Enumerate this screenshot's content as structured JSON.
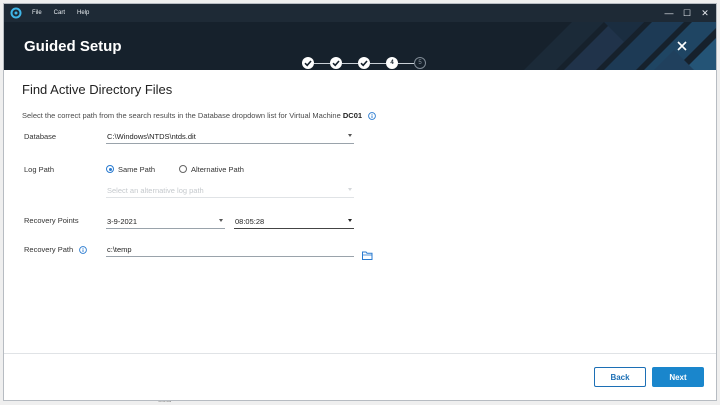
{
  "window": {
    "menu": [
      "File",
      "Cart",
      "Help"
    ],
    "controls": {
      "minimize": "—",
      "maximize": "☐",
      "close": "✕"
    }
  },
  "header": {
    "title": "Guided Setup",
    "steps": [
      {
        "state": "done",
        "label": ""
      },
      {
        "state": "done",
        "label": ""
      },
      {
        "state": "done",
        "label": ""
      },
      {
        "state": "current",
        "label": "4"
      },
      {
        "state": "future",
        "label": "5"
      }
    ]
  },
  "page": {
    "title": "Find Active Directory Files",
    "instruction_prefix": "Select the correct path from the search results in the Database dropdown list for Virtual Machine ",
    "vm_name": "DC01"
  },
  "form": {
    "database": {
      "label": "Database",
      "value": "C:\\Windows\\NTDS\\ntds.dit"
    },
    "log_path": {
      "label": "Log Path",
      "options": [
        "Same Path",
        "Alternative Path"
      ],
      "selected": "Same Path",
      "alternative_placeholder": "Select an alternative log path"
    },
    "recovery_points": {
      "label": "Recovery Points",
      "date": "3-9-2021",
      "time": "08:05:28"
    },
    "recovery_path": {
      "label": "Recovery Path",
      "value": "c:\\temp"
    }
  },
  "footer": {
    "back_label": "Back",
    "next_label": "Next"
  },
  "background": {
    "bottom_text": "Solid"
  },
  "colors": {
    "titlebar": "#1e2a36",
    "header": "#16212c",
    "accent": "#1a86cc",
    "radio": "#2a7bd0"
  },
  "icons": [
    "app-logo-icon",
    "info-icon",
    "folder-icon",
    "close-icon",
    "checkmark-icon"
  ]
}
